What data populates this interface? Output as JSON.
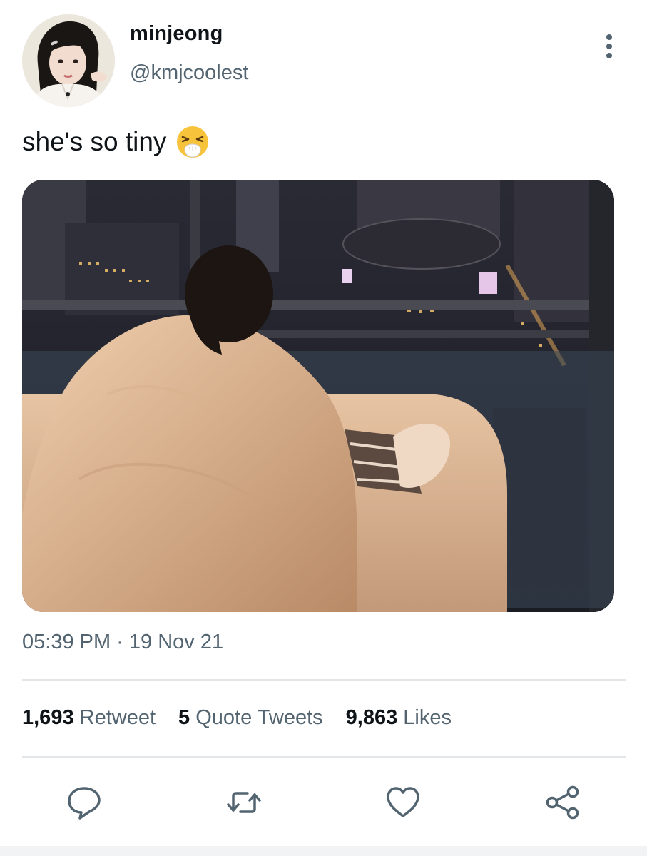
{
  "tweet": {
    "author": {
      "display_name": "minjeong",
      "handle": "@kmjcoolest",
      "avatar_icon": "profile-photo"
    },
    "more_icon": "more-vertical-icon",
    "text": "she's so tiny",
    "emoji": "sneezing-face-emoji",
    "media": {
      "kind": "photo",
      "icon": "photo-person-in-blanket-city-night"
    },
    "timestamp": "05:39 PM · 19 Nov 21",
    "stats": {
      "retweets": {
        "count": "1,693",
        "label": "Retweet"
      },
      "quotes": {
        "count": "5",
        "label": "Quote Tweets"
      },
      "likes": {
        "count": "9,863",
        "label": "Likes"
      }
    },
    "actions": {
      "reply_icon": "reply-icon",
      "retweet_icon": "retweet-icon",
      "like_icon": "heart-icon",
      "share_icon": "share-icon"
    }
  },
  "colors": {
    "text_primary": "#0f1419",
    "text_secondary": "#536471",
    "divider": "#e3e7ea"
  }
}
